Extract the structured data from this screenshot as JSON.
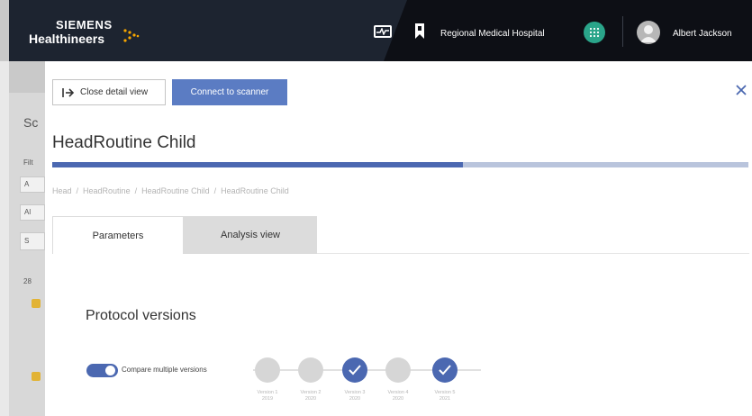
{
  "header": {
    "logo": {
      "line1": "SIEMENS",
      "line2": "Healthineers"
    },
    "monitor_icon": "monitor-waveform-icon",
    "bookmark_icon": "bookmark-icon",
    "hospital_name": "Regional Medical Hospital",
    "apps_icon": "grid-apps-icon",
    "avatar_icon": "user-avatar-icon",
    "user_name": "Albert Jackson",
    "colors": {
      "header_bg": "#1d2430",
      "apps_accent": "#2aa58a"
    }
  },
  "background_page": {
    "title_fragment": "Sc",
    "filter_fragment": "Filt",
    "field_a_fragment": "A",
    "field_b_fragment": "Al",
    "field_c_fragment": "S",
    "count_fragment": "28"
  },
  "panel": {
    "close_detail_label": "Close detail view",
    "close_detail_icon": "collapse-right-icon",
    "connect_label": "Connect to scanner",
    "close_icon": "close-icon",
    "title": "HeadRoutine Child",
    "progress_fraction": 0.59,
    "breadcrumb": [
      "Head",
      "HeadRoutine",
      "HeadRoutine Child",
      "HeadRoutine Child"
    ],
    "tabs": [
      {
        "label": "Parameters",
        "active": true
      },
      {
        "label": "Analysis view",
        "active": false
      }
    ],
    "section_title": "Protocol versions",
    "compare_toggle": {
      "label": "Compare multiple versions",
      "on": true
    },
    "versions": [
      {
        "label": "Version 1",
        "sub": "2019",
        "selected": false
      },
      {
        "label": "Version 2",
        "sub": "2020",
        "selected": false
      },
      {
        "label": "Version 3",
        "sub": "2020",
        "selected": true
      },
      {
        "label": "Version 4",
        "sub": "2020",
        "selected": false
      },
      {
        "label": "Version 5",
        "sub": "2021",
        "selected": true
      }
    ],
    "colors": {
      "accent": "#4b68b1",
      "button_blue": "#5b7cc3",
      "progress_track": "#b9c4dc",
      "inactive_node": "#d6d6d6"
    }
  }
}
